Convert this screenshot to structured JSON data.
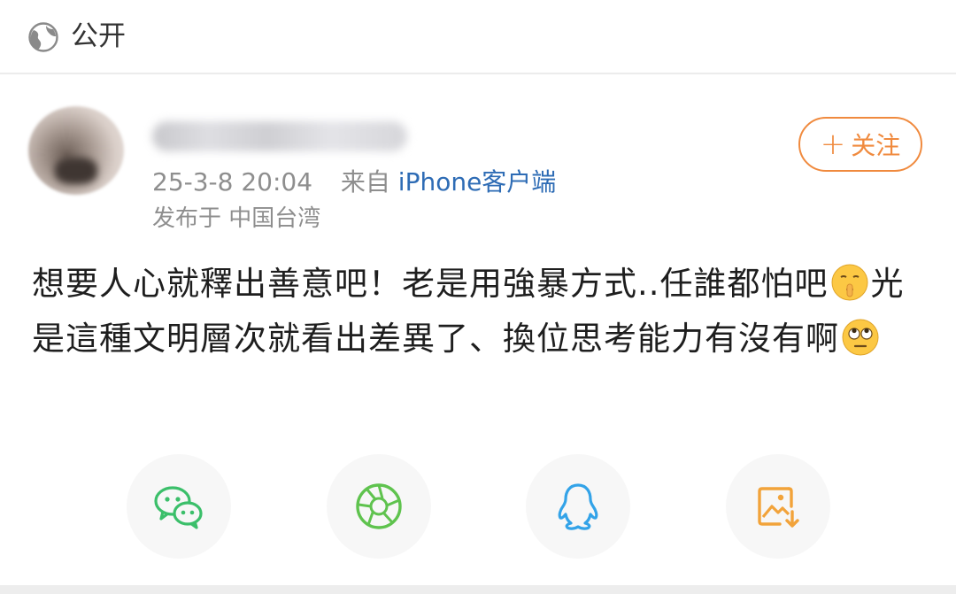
{
  "visibility": {
    "label": "公开",
    "icon": "globe-icon"
  },
  "post": {
    "author": {
      "avatar": "blurred-avatar",
      "name_blurred": true
    },
    "follow_label": "关注",
    "timestamp": "25-3-8 20:04",
    "source_prefix": "来自",
    "source_link": "iPhone客户端",
    "location": "发布于 中国台湾",
    "content": {
      "part1": "想要人心就釋出善意吧！老是用強暴方式..任誰都怕吧",
      "part2": "光是這種文明層次就看出差異了、換位思考能力有沒有啊",
      "emoji1": "shushing-face-emoji",
      "emoji2": "eye-roll-emoji"
    }
  },
  "share": [
    {
      "name": "wechat",
      "icon": "wechat-icon",
      "color": "#3bbf6a"
    },
    {
      "name": "moments",
      "icon": "moments-aperture-icon",
      "color": "#5fc34e"
    },
    {
      "name": "qq",
      "icon": "qq-penguin-icon",
      "color": "#33a3e8"
    },
    {
      "name": "save-image",
      "icon": "save-image-icon",
      "color": "#f2a33a"
    }
  ],
  "colors": {
    "accent": "#f08a3e",
    "link": "#2e6cb5",
    "meta": "#8e8e8e"
  }
}
